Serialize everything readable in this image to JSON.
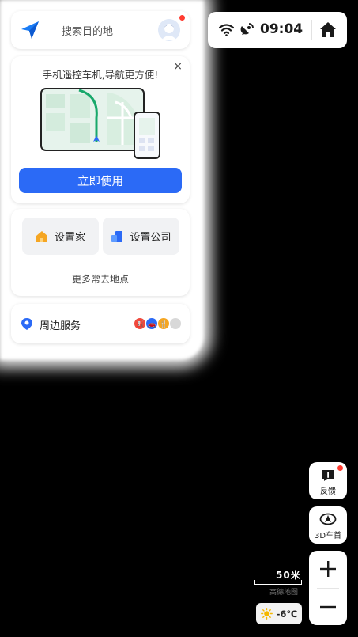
{
  "search": {
    "placeholder": "搜索目的地"
  },
  "promo": {
    "title": "手机遥控车机,导航更方便!",
    "close_glyph": "×",
    "cta_label": "立即使用"
  },
  "places": {
    "home_label": "设置家",
    "work_label": "设置公司",
    "more_label": "更多常去地点"
  },
  "nearby": {
    "label": "周边服务"
  },
  "status": {
    "time": "09:04"
  },
  "controls": {
    "feedback_label": "反馈",
    "view_label": "3D车首"
  },
  "map": {
    "scale_text": "50米",
    "map_label": "高德地图"
  },
  "weather": {
    "temperature": "-6℃"
  },
  "colors": {
    "accent": "#2b6af6",
    "home_icon": "#f5a623",
    "work_icon": "#2b6af6",
    "notification_dot": "#ff3b30"
  }
}
